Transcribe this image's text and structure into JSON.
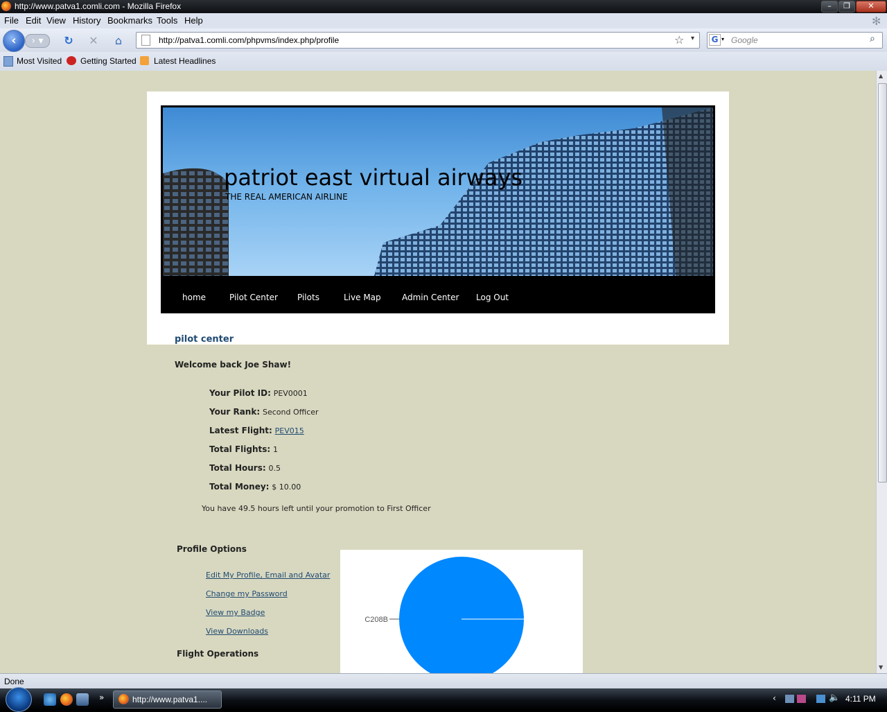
{
  "window": {
    "title": "http://www.patva1.comli.com - Mozilla Firefox",
    "controls": [
      "minimize",
      "maximize",
      "close"
    ]
  },
  "menubar": [
    "File",
    "Edit",
    "View",
    "History",
    "Bookmarks",
    "Tools",
    "Help"
  ],
  "navbar": {
    "url": "http://patva1.comli.com/phpvms/index.php/profile",
    "search_placeholder": "Google"
  },
  "bookmarks": [
    "Most Visited",
    "Getting Started",
    "Latest Headlines"
  ],
  "site": {
    "title": "patriot east virtual airways",
    "tagline": "THE REAL AMERICAN AIRLINE",
    "nav": [
      "home",
      "Pilot Center",
      "Pilots",
      "Live Map",
      "Admin Center",
      "Log Out"
    ]
  },
  "page": {
    "heading": "pilot center",
    "welcome": "Welcome back Joe Shaw!",
    "stats": [
      {
        "label": "Your Pilot ID:",
        "value": "PEV0001",
        "link": false
      },
      {
        "label": "Your Rank:",
        "value": "Second Officer",
        "link": false
      },
      {
        "label": "Latest Flight:",
        "value": "PEV015",
        "link": true
      },
      {
        "label": "Total Flights:",
        "value": "1",
        "link": false
      },
      {
        "label": "Total Hours:",
        "value": "0.5",
        "link": false
      },
      {
        "label": "Total Money:",
        "value": "$ 10.00",
        "link": false
      }
    ],
    "promotion": "You have 49.5 hours left until your promotion to First Officer",
    "profile_options_heading": "Profile Options",
    "profile_links": [
      "Edit My Profile, Email and Avatar",
      "Change my Password",
      "View my Badge",
      "View Downloads"
    ],
    "flight_ops_heading": "Flight Operations"
  },
  "chart_data": {
    "type": "pie",
    "categories": [
      "C208B"
    ],
    "values": [
      100
    ],
    "colors": [
      "#0088ff"
    ]
  },
  "statusbar": {
    "text": "Done"
  },
  "taskbar": {
    "active_window": "http://www.patva1....",
    "clock": "4:11 PM"
  }
}
